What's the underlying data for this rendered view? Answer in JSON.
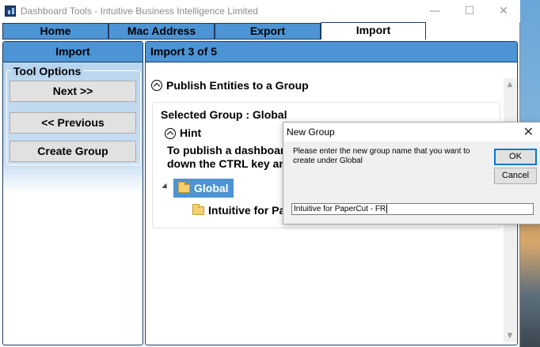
{
  "window": {
    "title": "Dashboard Tools - Intuitive Business Intelligence Limited",
    "minimize_glyph": "—",
    "maximize_glyph": "☐",
    "close_glyph": "✕"
  },
  "tabs": [
    {
      "label": "Home",
      "active": false
    },
    {
      "label": "Mac Address",
      "active": false
    },
    {
      "label": "Export",
      "active": false
    },
    {
      "label": "Import",
      "active": true
    }
  ],
  "left_panel": {
    "header": "Import",
    "group_label": "Tool Options",
    "buttons": {
      "next": "Next >>",
      "previous": "<< Previous",
      "create_group": "Create Group"
    }
  },
  "main_panel": {
    "header": "Import 3 of 5",
    "section_title": "Publish Entities to a Group",
    "selected_group_text": "Selected Group : Global",
    "hint_title": "Hint",
    "hint_line1": "To publish a dashboar",
    "hint_line2": "down the CTRL key an",
    "tree": {
      "root": "Global",
      "child": "Intuitive for Pa"
    }
  },
  "dialog": {
    "title": "New Group",
    "close_glyph": "✕",
    "message": "Please enter the new group name that you want to create under Global",
    "ok_label": "OK",
    "cancel_label": "Cancel",
    "input_value": "Intuitive for PaperCut - FR"
  },
  "icons": {
    "app": "app-icon",
    "collapse": "chevron-up-circle-icon",
    "folder": "folder-icon"
  },
  "colors": {
    "tab_blue": "#4d94d4",
    "panel_border": "#1b3d63",
    "selection_blue": "#4d94d4"
  }
}
